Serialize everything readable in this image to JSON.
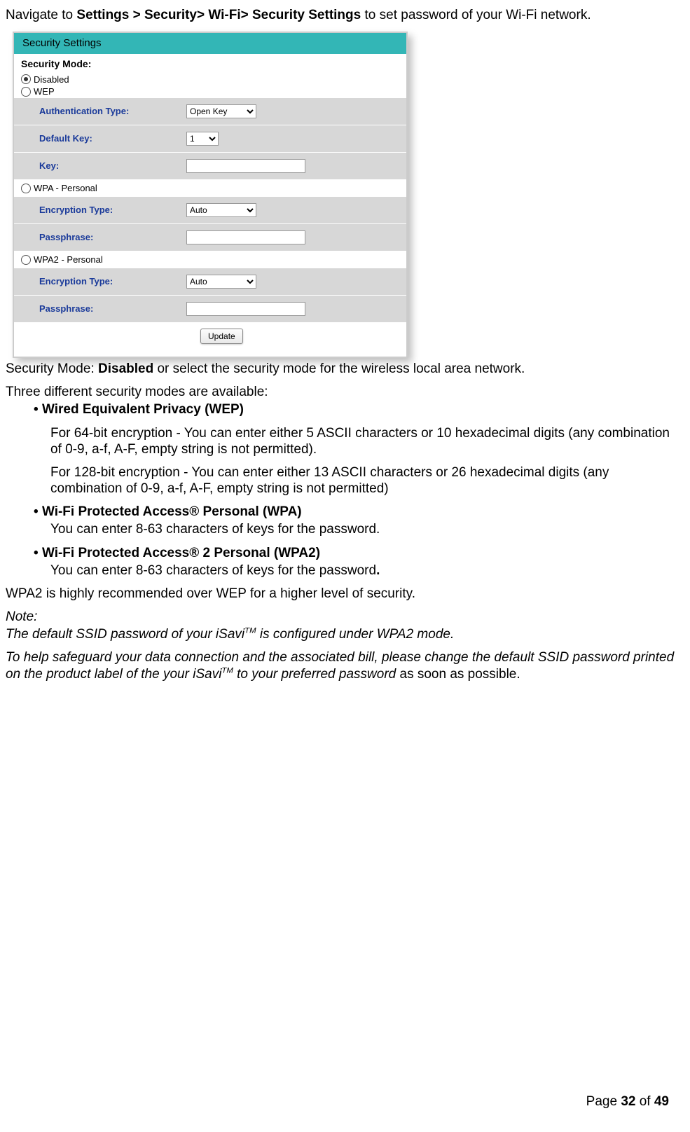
{
  "intro": {
    "prefix": "Navigate to ",
    "b1": "Settings > Security> Wi-Fi> Security Settings",
    "suffix": " to set password of your Wi-Fi network."
  },
  "screenshot": {
    "title": "Security Settings",
    "security_mode_label": "Security Mode:",
    "radios": {
      "disabled": "Disabled",
      "wep": "WEP",
      "wpa": "WPA - Personal",
      "wpa2": "WPA2 - Personal"
    },
    "fields": {
      "auth_type": "Authentication Type:",
      "auth_type_val": "Open Key",
      "default_key": "Default Key:",
      "default_key_val": "1",
      "key": "Key:",
      "enc_type": "Encryption Type:",
      "enc_type_val": "Auto",
      "passphrase": "Passphrase:"
    },
    "update": "Update"
  },
  "after_shot": {
    "line1_a": "Security Mode:  ",
    "line1_b": "Disabled",
    "line1_c": " or select the security mode for the wireless local area network.",
    "line2": "Three different security modes are available:"
  },
  "wep": {
    "title": "Wired Equivalent Privacy (WEP)",
    "p1": "For 64-bit encryption - You can enter either 5 ASCII characters or 10 hexadecimal digits (any combination of 0-9, a-f, A-F, empty string is not permitted).",
    "p2": "For 128-bit encryption - You can enter either 13 ASCII characters or 26 hexadecimal digits (any combination of 0-9, a-f, A-F, empty string is not permitted)"
  },
  "wpa": {
    "title": "Wi-Fi Protected Access® Personal (WPA)",
    "p1": "You can enter 8-63 characters of keys for the password."
  },
  "wpa2": {
    "title": "Wi-Fi Protected Access® 2 Personal (WPA2)",
    "p1_a": "You can enter 8-63 characters of keys for the password",
    "p1_b": "."
  },
  "rec": "WPA2 is highly recommended over WEP for a higher level of security.",
  "note": {
    "head": "Note:",
    "line1_a": "The default SSID password of your iSavi",
    "tm": "TM",
    "line1_b": " is configured under WPA2 mode.",
    "line2_a": "To help safeguard your data connection and the associated bill, please change the default SSID password printed on the product label of the your iSavi",
    "line2_b": " to your preferred password",
    "line2_c": " as soon as possible."
  },
  "footer": {
    "a": "Page ",
    "b": "32",
    "c": " of ",
    "d": "49"
  }
}
